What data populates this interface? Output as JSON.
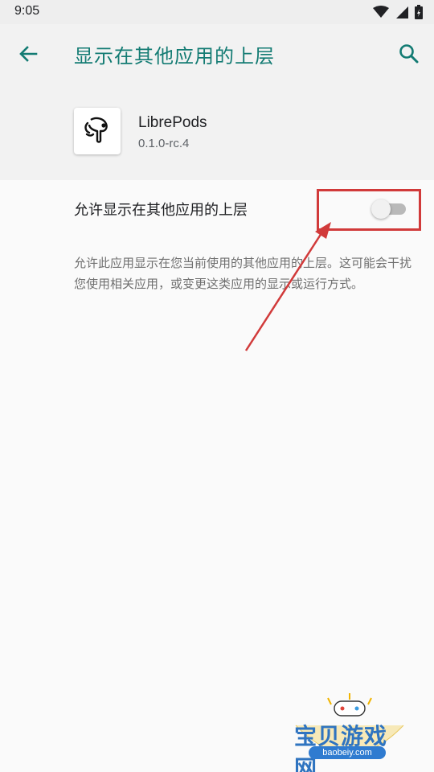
{
  "status_bar": {
    "time": "9:05"
  },
  "toolbar": {
    "title": "显示在其他应用的上层"
  },
  "app": {
    "name": "LibrePods",
    "version": "0.1.0-rc.4"
  },
  "setting": {
    "label": "允许显示在其他应用的上层",
    "enabled": false,
    "description": "允许此应用显示在您当前使用的其他应用的上层。这可能会干扰您使用相关应用，或变更这类应用的显示或运行方式。"
  },
  "watermark": {
    "title": "宝贝游戏网",
    "url": "baobeiy.com"
  },
  "colors": {
    "accent": "#137b73",
    "annotation": "#d13a3a",
    "watermark": "#2f74c0"
  }
}
